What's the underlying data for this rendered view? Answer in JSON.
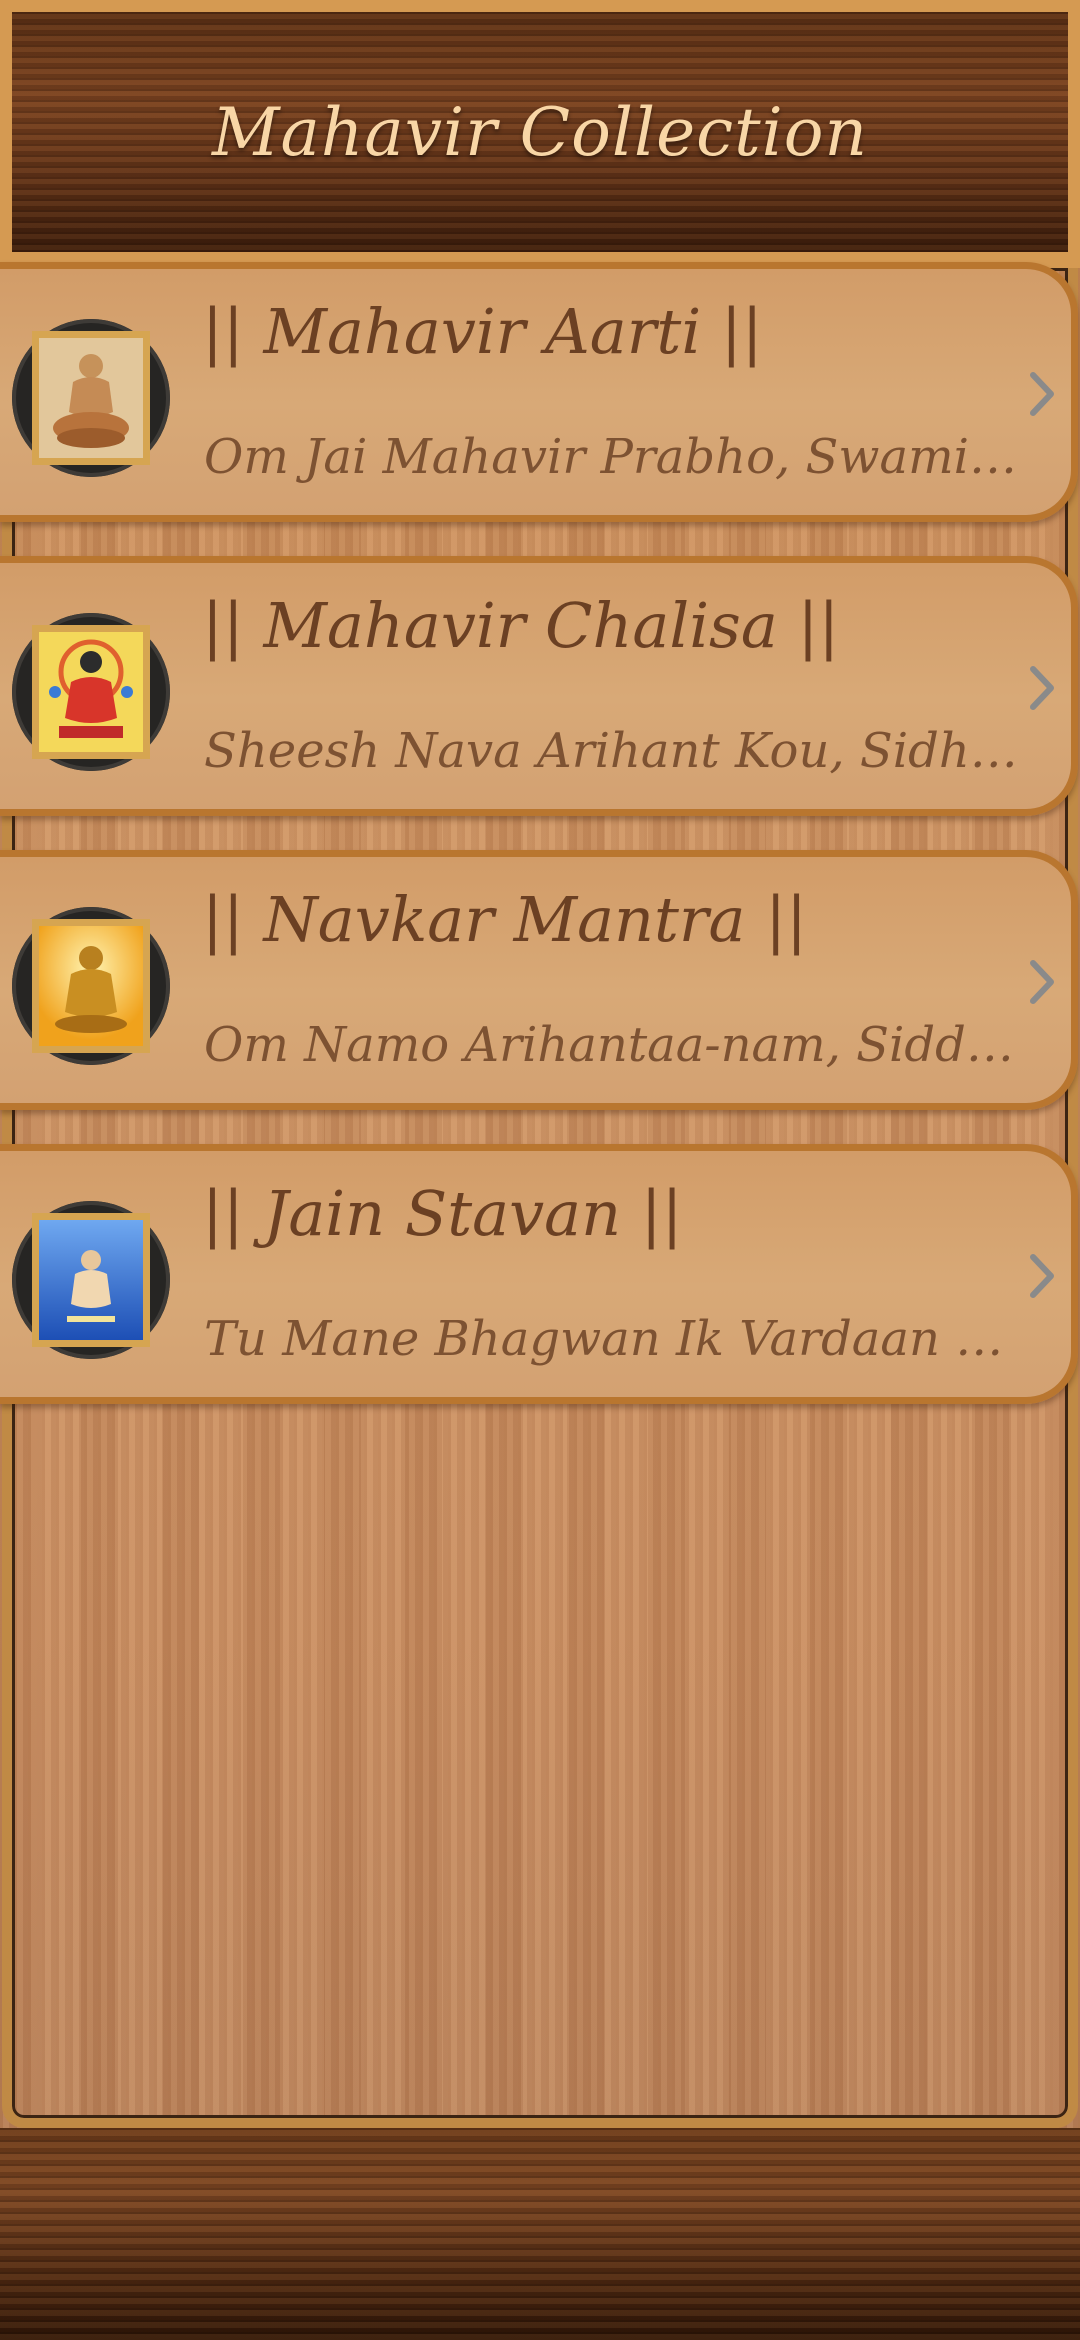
{
  "app": {
    "title": "Mahavir Collection"
  },
  "items": [
    {
      "title": "|| Mahavir Aarti ||",
      "subtitle": "Om Jai Mahavir Prabho, Swami Jai Mahavir Prabho",
      "thumb_icon": "mahavir-seated-icon",
      "thumb_bg": "#d9b98a"
    },
    {
      "title": "|| Mahavir Chalisa ||",
      "subtitle": "Sheesh Nava Arihant Kou, Sidhaan Karoon Pranaam",
      "thumb_icon": "mahavir-red-robe-icon",
      "thumb_bg": "#f2d24a"
    },
    {
      "title": "|| Navkar Mantra ||",
      "subtitle": "Om Namo Arihantaa-nam, Siddhaa-nam",
      "thumb_icon": "mahavir-golden-icon",
      "thumb_bg": "#f5c83a"
    },
    {
      "title": "|| Jain Stavan ||",
      "subtitle": "Tu Mane Bhagwan Ik Vardaan Aapi De",
      "thumb_icon": "mahavir-blue-icon",
      "thumb_bg": "#2a62c8"
    }
  ],
  "colors": {
    "header_text": "#f8d6a6",
    "card_title": "#6b4023",
    "card_subtitle": "#7d5232",
    "card_border": "#b9762f",
    "chevron": "#8a8a8a"
  }
}
